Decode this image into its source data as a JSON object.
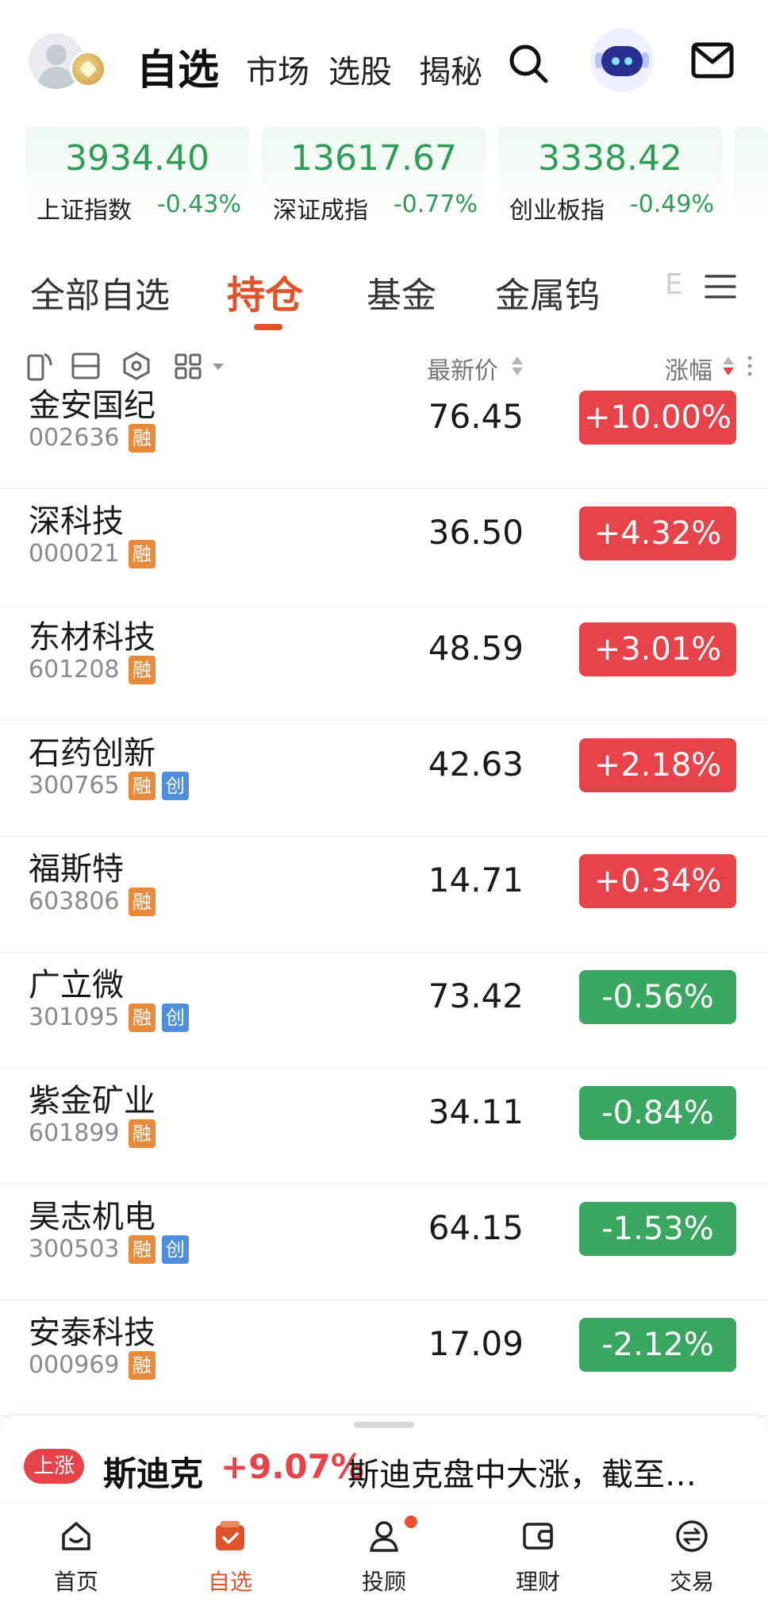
{
  "header": {
    "title": "自选",
    "links": [
      "市场",
      "选股",
      "揭秘"
    ]
  },
  "indices": [
    {
      "value": "3934.40",
      "name": "上证指数",
      "change": "-0.43%"
    },
    {
      "value": "13617.67",
      "name": "深证成指",
      "change": "-0.77%"
    },
    {
      "value": "3338.42",
      "name": "创业板指",
      "change": "-0.49%"
    }
  ],
  "tabs": {
    "items": [
      "全部自选",
      "持仓",
      "基金",
      "金属钨"
    ],
    "active": "持仓",
    "overflow_hint": "E"
  },
  "columns": {
    "price": "最新价",
    "change": "涨幅"
  },
  "stocks": [
    {
      "name": "金安国纪",
      "code": "002636",
      "tags": [
        "融"
      ],
      "price": "76.45",
      "change": "+10.00%",
      "direction": "up"
    },
    {
      "name": "深科技",
      "code": "000021",
      "tags": [
        "融"
      ],
      "price": "36.50",
      "change": "+4.32%",
      "direction": "up"
    },
    {
      "name": "东材科技",
      "code": "601208",
      "tags": [
        "融"
      ],
      "price": "48.59",
      "change": "+3.01%",
      "direction": "up"
    },
    {
      "name": "石药创新",
      "code": "300765",
      "tags": [
        "融",
        "创"
      ],
      "price": "42.63",
      "change": "+2.18%",
      "direction": "up"
    },
    {
      "name": "福斯特",
      "code": "603806",
      "tags": [
        "融"
      ],
      "price": "14.71",
      "change": "+0.34%",
      "direction": "up"
    },
    {
      "name": "广立微",
      "code": "301095",
      "tags": [
        "融",
        "创"
      ],
      "price": "73.42",
      "change": "-0.56%",
      "direction": "down"
    },
    {
      "name": "紫金矿业",
      "code": "601899",
      "tags": [
        "融"
      ],
      "price": "34.11",
      "change": "-0.84%",
      "direction": "down"
    },
    {
      "name": "昊志机电",
      "code": "300503",
      "tags": [
        "融",
        "创"
      ],
      "price": "64.15",
      "change": "-1.53%",
      "direction": "down"
    },
    {
      "name": "安泰科技",
      "code": "000969",
      "tags": [
        "融"
      ],
      "price": "17.09",
      "change": "-2.12%",
      "direction": "down"
    }
  ],
  "ticker": {
    "tag": "上涨",
    "stock": "斯迪克",
    "change": "+9.07%",
    "text": "斯迪克盘中大涨，截至…"
  },
  "bottom_nav": [
    {
      "label": "首页",
      "icon": "home-icon",
      "active": false
    },
    {
      "label": "自选",
      "icon": "watchlist-icon",
      "active": true
    },
    {
      "label": "投顾",
      "icon": "advisor-icon",
      "active": false,
      "badge": true
    },
    {
      "label": "理财",
      "icon": "wallet-icon",
      "active": false
    },
    {
      "label": "交易",
      "icon": "trade-icon",
      "active": false
    }
  ],
  "colors": {
    "accent": "#e0532a",
    "up": "#e8434a",
    "down": "#3aa760",
    "index_green": "#2e9e57"
  }
}
